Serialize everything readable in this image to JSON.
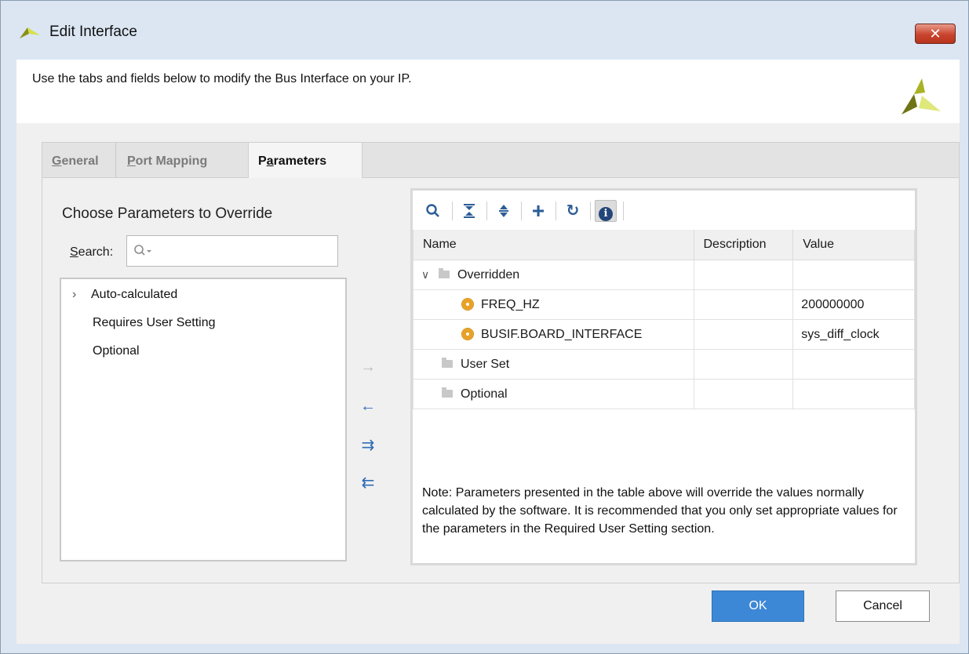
{
  "window": {
    "title": "Edit Interface",
    "close_label": "✕"
  },
  "banner": {
    "text": "Use the tabs and fields below to modify the Bus Interface on your IP."
  },
  "tabs": [
    {
      "prefix": "",
      "mnemonic": "G",
      "rest": "eneral"
    },
    {
      "prefix": "",
      "mnemonic": "P",
      "rest": "ort Mapping"
    },
    {
      "prefix": "P",
      "mnemonic": "a",
      "rest": "rameters"
    }
  ],
  "left": {
    "title": "Choose Parameters to Override",
    "search_mnemonic": "S",
    "search_rest": "earch:",
    "tree": [
      {
        "label": "Auto-calculated",
        "expander": "›"
      },
      {
        "label": "Requires User Setting"
      },
      {
        "label": "Optional"
      }
    ]
  },
  "transfer": {
    "add_icon": "→",
    "remove_icon": "←",
    "add_all_icon": "⇉",
    "remove_all_icon": "⇇"
  },
  "toolbar": {
    "icons": [
      "search-icon",
      "collapse-all-icon",
      "expand-all-icon",
      "add-icon",
      "refresh-icon",
      "info-icon"
    ],
    "glyphs": {
      "search": "⚲",
      "collapse": "⩢",
      "expand": "⇕",
      "add": "+",
      "refresh": "↻",
      "info": "i"
    }
  },
  "table": {
    "headers": [
      "Name",
      "Description",
      "Value"
    ],
    "rows": [
      {
        "name": "Overridden",
        "type": "group",
        "expanded": true,
        "description": "",
        "value": ""
      },
      {
        "name": "FREQ_HZ",
        "type": "param",
        "description": "",
        "value": "200000000"
      },
      {
        "name": "BUSIF.BOARD_INTERFACE",
        "type": "param",
        "description": "",
        "value": "sys_diff_clock"
      },
      {
        "name": "User Set",
        "type": "group",
        "description": "",
        "value": ""
      },
      {
        "name": "Optional",
        "type": "group",
        "description": "",
        "value": ""
      }
    ]
  },
  "note": "Note: Parameters presented in the table above will override the values normally calculated by the software. It is recommended that you only set appropriate values for the parameters in the Required User Setting section.",
  "buttons": {
    "ok": "OK",
    "cancel": "Cancel"
  },
  "colors": {
    "accent": "#3d88d6",
    "titlebar": "#dbe6f2",
    "close": "#c9442e"
  }
}
